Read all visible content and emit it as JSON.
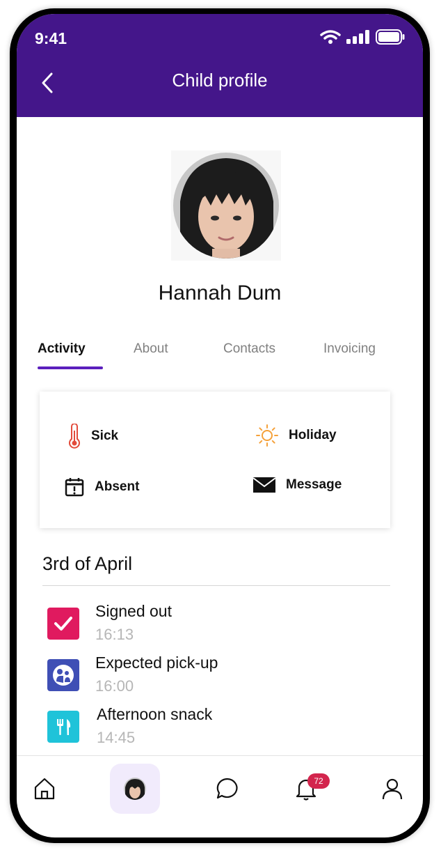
{
  "status_bar": {
    "time": "9:41"
  },
  "header": {
    "title": "Child profile"
  },
  "profile": {
    "name": "Hannah Dum"
  },
  "tabs": [
    {
      "label": "Activity",
      "active": true
    },
    {
      "label": "About"
    },
    {
      "label": "Contacts"
    },
    {
      "label": "Invoicing"
    }
  ],
  "quick_actions": {
    "sick": "Sick",
    "holiday": "Holiday",
    "absent": "Absent",
    "message": "Message"
  },
  "timeline": {
    "date": "3rd of April",
    "events": [
      {
        "title": "Signed out",
        "time": "16:13",
        "icon": "check-icon",
        "color": "#e01a5f"
      },
      {
        "title": "Expected pick-up",
        "time": "16:00",
        "icon": "pickup-icon",
        "color": "#3f4fb5"
      },
      {
        "title": "Afternoon snack",
        "time": "14:45",
        "icon": "cutlery-icon",
        "color": "#1fc3d9"
      }
    ]
  },
  "tab_bar": {
    "notifications_badge": "72"
  },
  "colors": {
    "brand": "#44168a",
    "accent": "#5b1fbd",
    "badge": "#d3254d"
  }
}
